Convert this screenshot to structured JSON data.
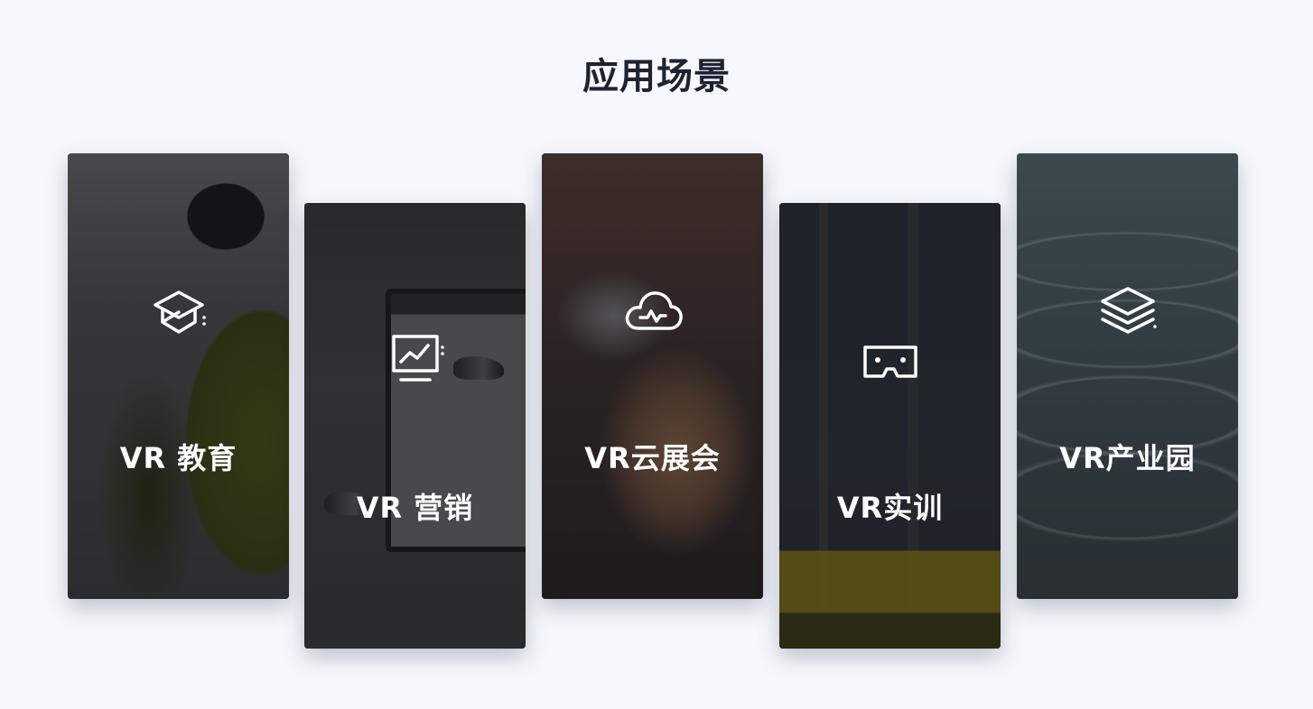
{
  "section": {
    "title": "应用场景"
  },
  "cards": [
    {
      "label": "VR 教育",
      "icon": "graduation-cap-icon"
    },
    {
      "label": "VR 营销",
      "icon": "chart-screen-icon"
    },
    {
      "label": "VR云展会",
      "icon": "cloud-pulse-icon"
    },
    {
      "label": "VR实训",
      "icon": "vr-goggles-icon"
    },
    {
      "label": "VR产业园",
      "icon": "stacked-layers-icon"
    }
  ],
  "colors": {
    "page_background": "#f6f8fd",
    "title_text": "#1d2330",
    "card_text": "#ffffff"
  }
}
